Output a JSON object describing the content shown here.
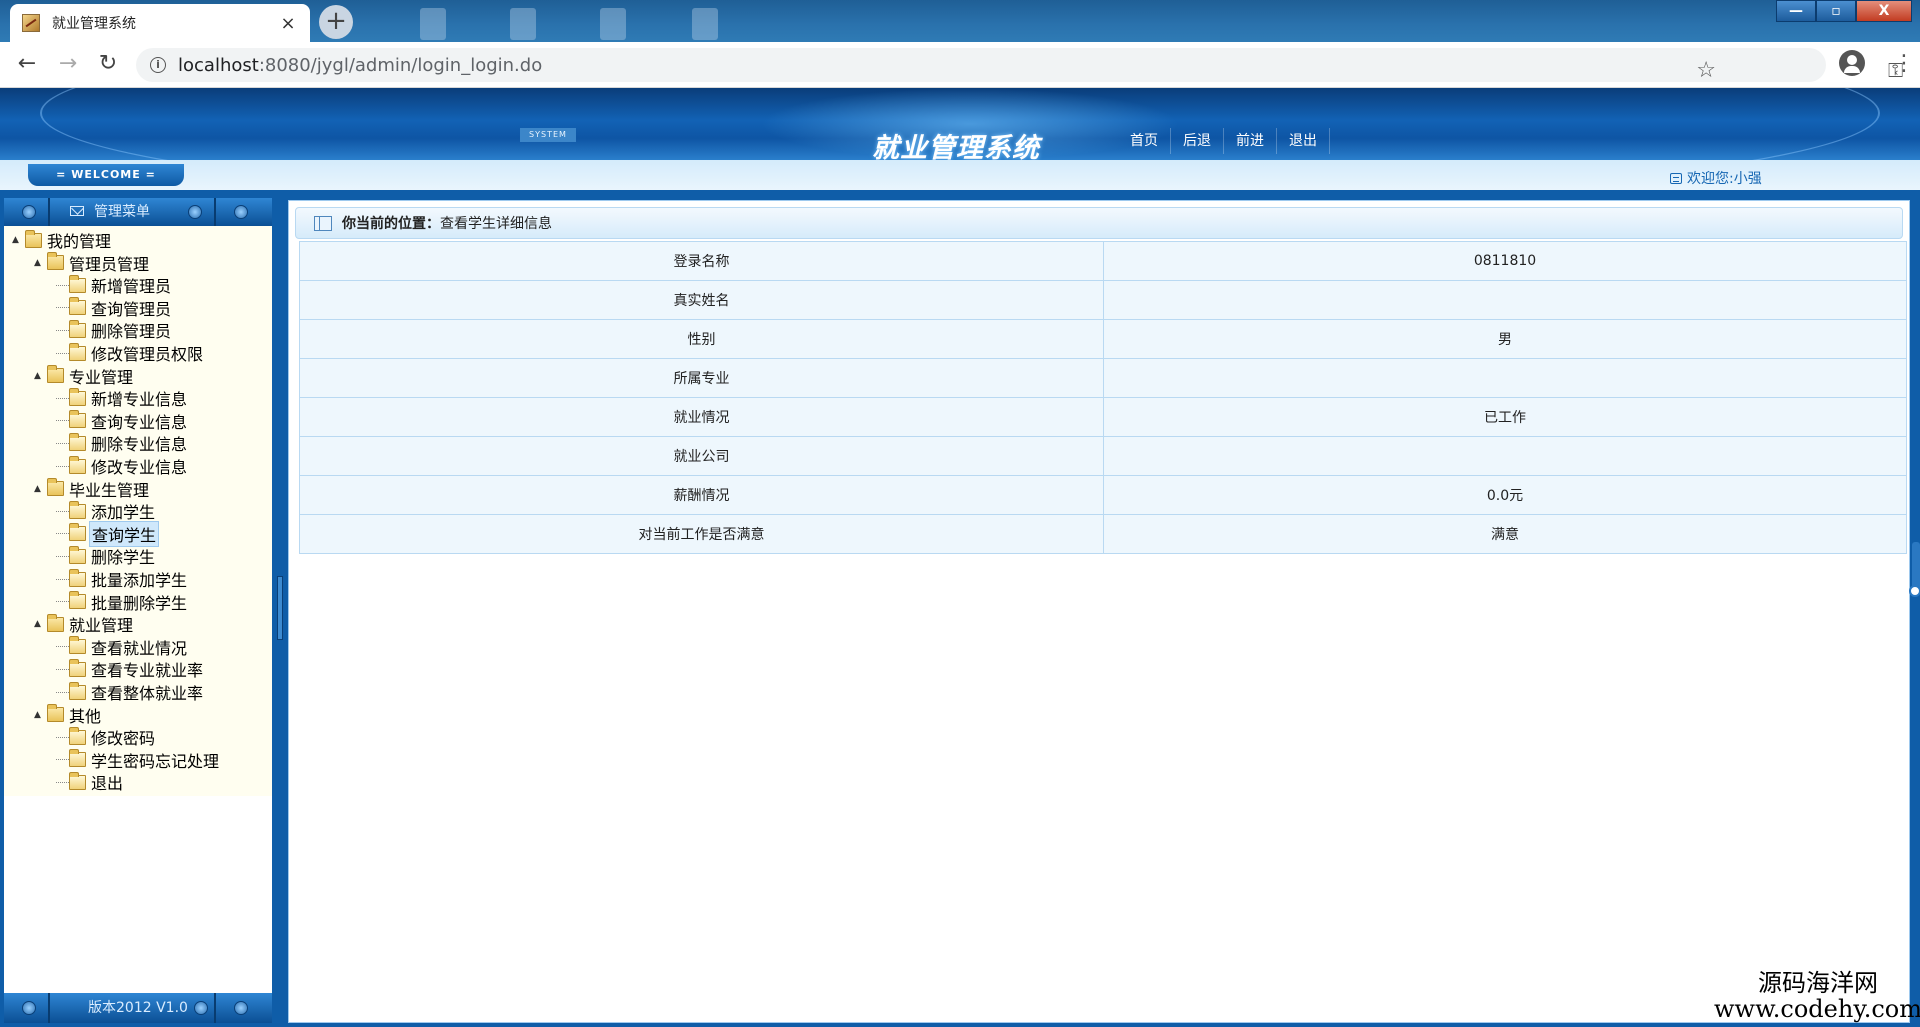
{
  "browser": {
    "tab_title": "就业管理系统",
    "close_glyph": "×",
    "newtab_glyph": "+",
    "url_host": "localhost",
    "url_path": ":8080/jygl/admin/login_login.do",
    "window_min": "—",
    "window_max": "▫",
    "window_close": "X"
  },
  "header": {
    "system_tag": "SYSTEM",
    "title": "就业管理系统",
    "nav": [
      "首页",
      "后退",
      "前进",
      "退出"
    ]
  },
  "welcome": {
    "badge": "= WELCOME =",
    "user": "欢迎您:小强"
  },
  "sidebar": {
    "title": "管理菜单",
    "footer": "版本2012 V1.0",
    "tree": [
      {
        "label": "我的管理",
        "level": 0,
        "type": "folder"
      },
      {
        "label": "管理员管理",
        "level": 1,
        "type": "folder"
      },
      {
        "label": "新增管理员",
        "level": 2,
        "type": "page"
      },
      {
        "label": "查询管理员",
        "level": 2,
        "type": "page"
      },
      {
        "label": "删除管理员",
        "level": 2,
        "type": "page"
      },
      {
        "label": "修改管理员权限",
        "level": 2,
        "type": "page"
      },
      {
        "label": "专业管理",
        "level": 1,
        "type": "folder"
      },
      {
        "label": "新增专业信息",
        "level": 2,
        "type": "page"
      },
      {
        "label": "查询专业信息",
        "level": 2,
        "type": "page"
      },
      {
        "label": "删除专业信息",
        "level": 2,
        "type": "page"
      },
      {
        "label": "修改专业信息",
        "level": 2,
        "type": "page"
      },
      {
        "label": "毕业生管理",
        "level": 1,
        "type": "folder"
      },
      {
        "label": "添加学生",
        "level": 2,
        "type": "page"
      },
      {
        "label": "查询学生",
        "level": 2,
        "type": "page",
        "selected": true
      },
      {
        "label": "删除学生",
        "level": 2,
        "type": "page"
      },
      {
        "label": "批量添加学生",
        "level": 2,
        "type": "page"
      },
      {
        "label": "批量删除学生",
        "level": 2,
        "type": "page"
      },
      {
        "label": "就业管理",
        "level": 1,
        "type": "folder"
      },
      {
        "label": "查看就业情况",
        "level": 2,
        "type": "page"
      },
      {
        "label": "查看专业就业率",
        "level": 2,
        "type": "page"
      },
      {
        "label": "查看整体就业率",
        "level": 2,
        "type": "page"
      },
      {
        "label": "其他",
        "level": 1,
        "type": "folder"
      },
      {
        "label": "修改密码",
        "level": 2,
        "type": "page"
      },
      {
        "label": "学生密码忘记处理",
        "level": 2,
        "type": "page"
      },
      {
        "label": "退出",
        "level": 2,
        "type": "page"
      }
    ]
  },
  "main": {
    "breadcrumb_label": "你当前的位置",
    "breadcrumb_sep": "：",
    "breadcrumb_value": "查看学生详细信息",
    "details": [
      {
        "key": "登录名称",
        "value": "0811810"
      },
      {
        "key": "真实姓名",
        "value": ""
      },
      {
        "key": "性别",
        "value": "男"
      },
      {
        "key": "所属专业",
        "value": ""
      },
      {
        "key": "就业情况",
        "value": "已工作"
      },
      {
        "key": "就业公司",
        "value": ""
      },
      {
        "key": "薪酬情况",
        "value": "0.0元"
      },
      {
        "key": "对当前工作是否满意",
        "value": "满意"
      }
    ]
  },
  "watermark": {
    "line1": "源码海洋网",
    "line2": "www.codehy.com"
  }
}
